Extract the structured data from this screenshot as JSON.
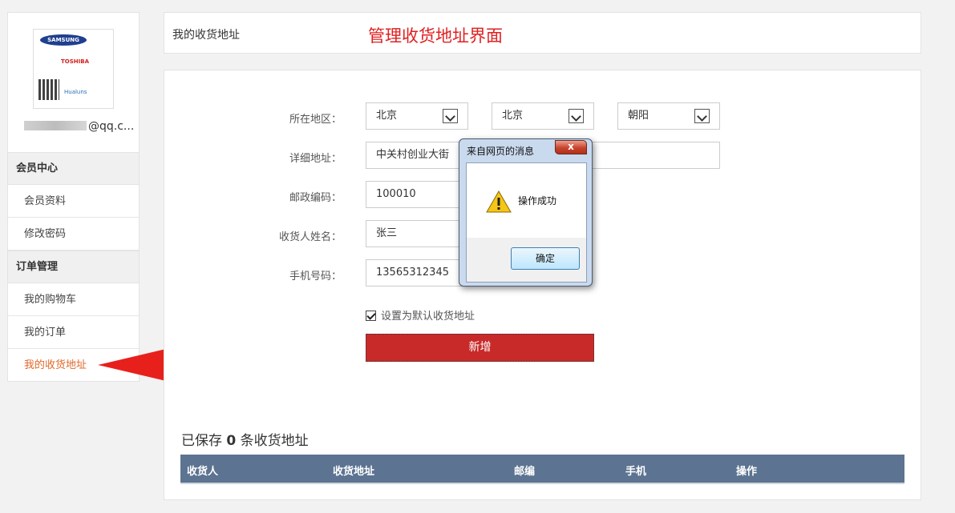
{
  "user": {
    "email_suffix": "@qq.c..."
  },
  "sidebar": {
    "groups": [
      {
        "label": "会员中心",
        "items": [
          "会员资料",
          "修改密码"
        ]
      },
      {
        "label": "订单管理",
        "items": [
          "我的购物车",
          "我的订单",
          "我的收货地址"
        ]
      }
    ],
    "active_item": "我的收货地址"
  },
  "header": {
    "breadcrumb": "我的收货地址",
    "headline": "管理收货地址界面",
    "headline_color": "#e02020"
  },
  "form": {
    "region_label": "所在地区：",
    "province": "北京",
    "city": "北京",
    "district": "朝阳",
    "address_label": "详细地址：",
    "address_value": "中关村创业大街",
    "zip_label": "邮政编码：",
    "zip_value": "100010",
    "name_label": "收货人姓名：",
    "name_value": "张三",
    "phone_label": "手机号码：",
    "phone_value": "13565312345",
    "default_checkbox_label": "设置为默认收货地址",
    "default_checked": true,
    "submit_label": "新增",
    "submit_color": "#c82a2a"
  },
  "saved": {
    "prefix": "已保存",
    "count": "0",
    "suffix": "条收货地址"
  },
  "table": {
    "headers": [
      "收货人",
      "收货地址",
      "邮编",
      "手机",
      "操作"
    ],
    "header_color": "#5c7391"
  },
  "dialog": {
    "title": "来自网页的消息",
    "close_glyph": "x",
    "icon": "warning-icon",
    "message": "操作成功",
    "ok_label": "确定"
  }
}
